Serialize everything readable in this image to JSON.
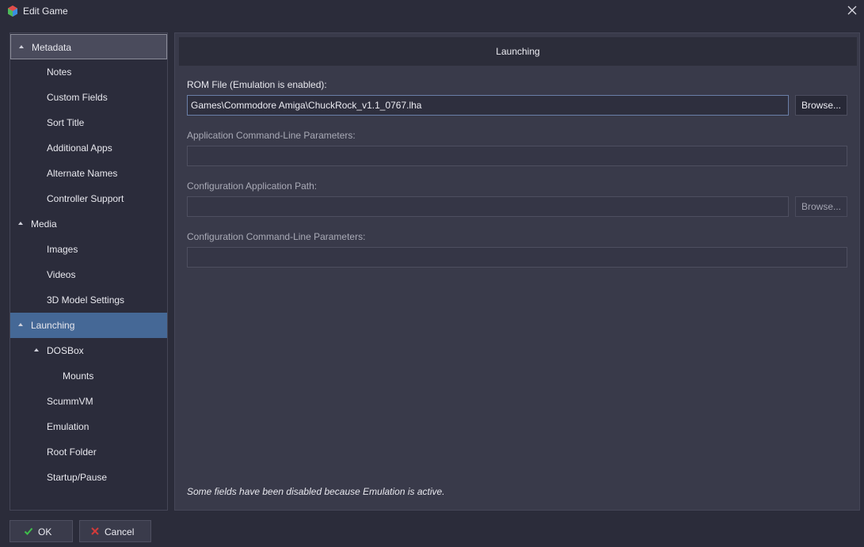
{
  "window": {
    "title": "Edit Game"
  },
  "sidebar": {
    "items": [
      {
        "label": "Metadata",
        "level": 0,
        "expanded": true,
        "state": "outlined"
      },
      {
        "label": "Notes",
        "level": 1
      },
      {
        "label": "Custom Fields",
        "level": 1
      },
      {
        "label": "Sort Title",
        "level": 1
      },
      {
        "label": "Additional Apps",
        "level": 1
      },
      {
        "label": "Alternate Names",
        "level": 1
      },
      {
        "label": "Controller Support",
        "level": 1
      },
      {
        "label": "Media",
        "level": 0,
        "expanded": true
      },
      {
        "label": "Images",
        "level": 1
      },
      {
        "label": "Videos",
        "level": 1
      },
      {
        "label": "3D Model Settings",
        "level": 1
      },
      {
        "label": "Launching",
        "level": 0,
        "expanded": true,
        "state": "selected"
      },
      {
        "label": "DOSBox",
        "level": 1,
        "expanded": true
      },
      {
        "label": "Mounts",
        "level": 2
      },
      {
        "label": "ScummVM",
        "level": 1
      },
      {
        "label": "Emulation",
        "level": 1
      },
      {
        "label": "Root Folder",
        "level": 1
      },
      {
        "label": "Startup/Pause",
        "level": 1
      }
    ]
  },
  "main": {
    "header_title": "Launching",
    "rom_file": {
      "label": "ROM File (Emulation is enabled):",
      "value": "Games\\Commodore Amiga\\ChuckRock_v1.1_0767.lha",
      "browse_label": "Browse..."
    },
    "app_params": {
      "label": "Application Command-Line Parameters:",
      "value": ""
    },
    "config_path": {
      "label": "Configuration Application Path:",
      "value": "",
      "browse_label": "Browse..."
    },
    "config_params": {
      "label": "Configuration Command-Line Parameters:",
      "value": ""
    },
    "note": "Some fields have been disabled because Emulation is active."
  },
  "footer": {
    "ok_label": "OK",
    "cancel_label": "Cancel"
  },
  "colors": {
    "selected": "#456896",
    "ok_icon": "#3fbf4a",
    "cancel_icon": "#d23a3a"
  }
}
